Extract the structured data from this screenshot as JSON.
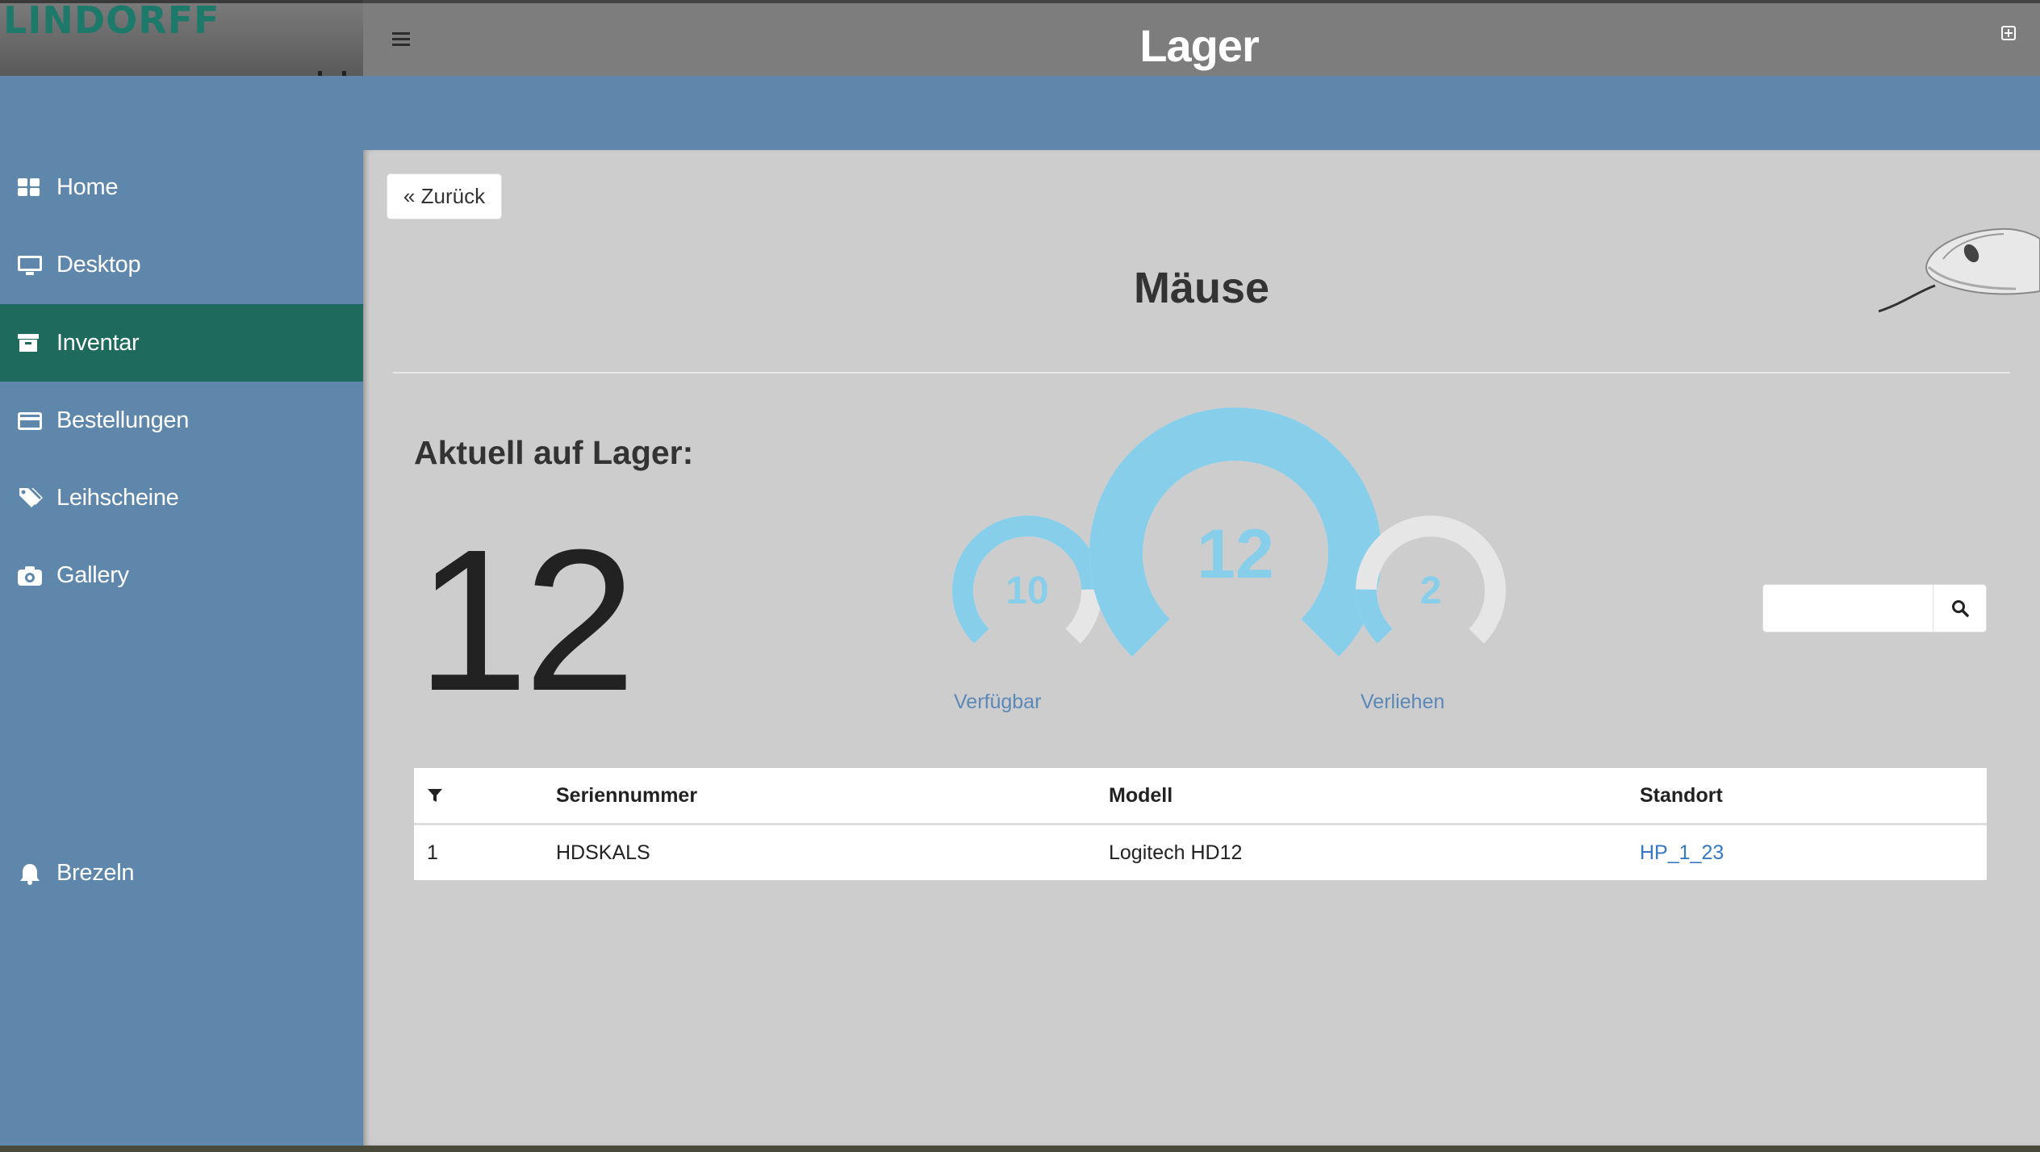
{
  "brand": {
    "logo_text": "LINDORFF"
  },
  "header": {
    "title": "Lager"
  },
  "sidebar": {
    "items": [
      {
        "label": "Home",
        "icon": "grid-icon"
      },
      {
        "label": "Desktop",
        "icon": "desktop-icon"
      },
      {
        "label": "Inventar",
        "icon": "archive-icon",
        "active": true
      },
      {
        "label": "Bestellungen",
        "icon": "credit-card-icon"
      },
      {
        "label": "Leihscheine",
        "icon": "tags-icon"
      },
      {
        "label": "Gallery",
        "icon": "camera-icon"
      }
    ],
    "footer_item": {
      "label": "Brezeln",
      "icon": "bell-icon"
    }
  },
  "main": {
    "back_label": "« Zurück",
    "heading": "Mäuse",
    "stock_label": "Aktuell auf Lager:",
    "stock_count": "12",
    "gauges": {
      "available": {
        "value": "10",
        "fill_fraction": 0.83,
        "caption": "Verfügbar"
      },
      "total": {
        "value": "12",
        "fill_fraction": 1.0
      },
      "lent": {
        "value": "2",
        "fill_fraction": 0.17,
        "caption": "Verliehen"
      }
    },
    "search": {
      "placeholder": ""
    },
    "table": {
      "columns": [
        "Seriennummer",
        "Modell",
        "Standort"
      ],
      "rows": [
        {
          "index": "1",
          "serial": "HDSKALS",
          "model": "Logitech HD12",
          "location": "HP_1_23"
        }
      ]
    }
  },
  "colors": {
    "sidebar_bg": "#5f87ab",
    "sidebar_active": "#1e6a5d",
    "topbar_bg": "#7d7d7d",
    "gauge_blue": "#87ceeb",
    "gauge_empty": "#e6e6e6",
    "link": "#3579c2"
  }
}
